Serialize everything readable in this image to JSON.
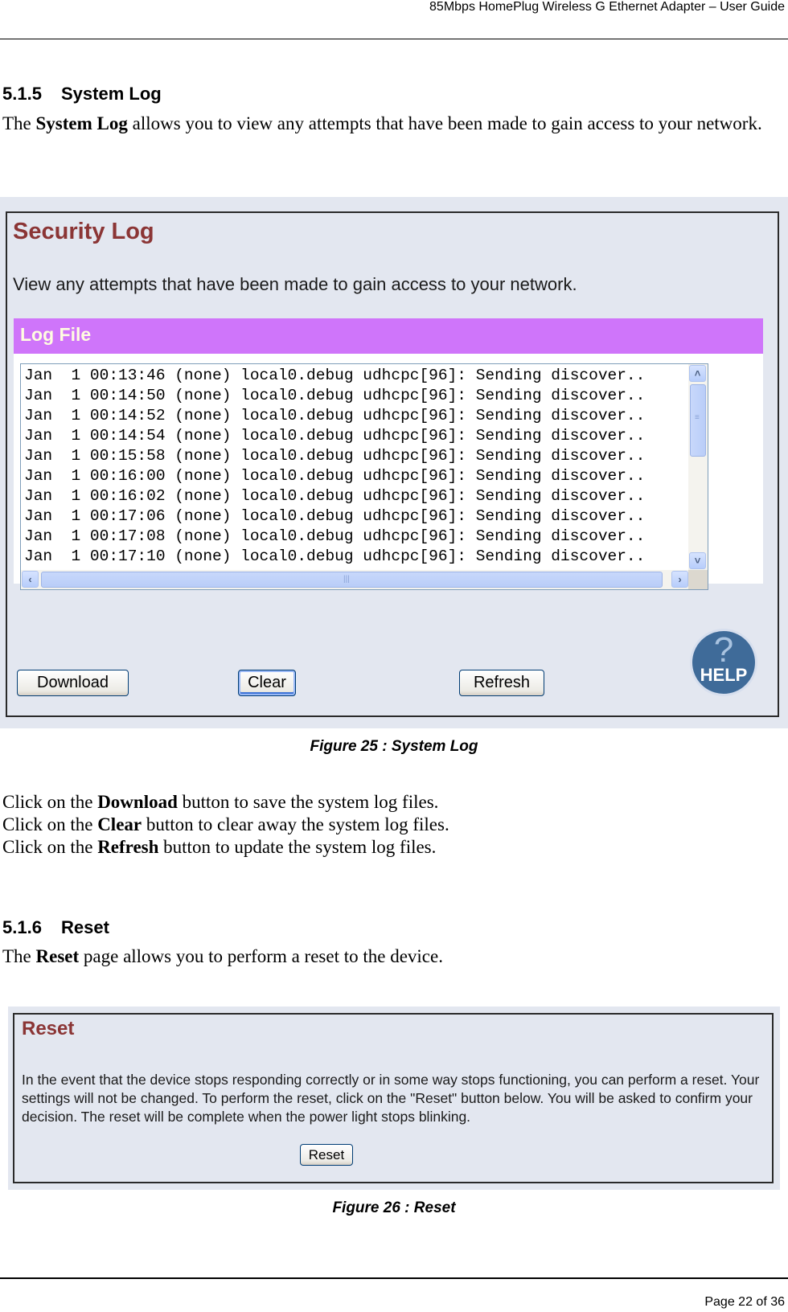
{
  "header": {
    "title": "85Mbps HomePlug Wireless G Ethernet Adapter – User Guide"
  },
  "section_system_log": {
    "number": "5.1.5",
    "title": "System Log",
    "intro_prefix": "The ",
    "intro_bold": "System Log",
    "intro_suffix": " allows you to view any attempts that have been made to gain access to your network."
  },
  "figure25": {
    "panel_title": "Security Log",
    "panel_description": "View any attempts that have been made to gain access to your network.",
    "log_file_label": "Log File",
    "log_lines": [
      "Jan  1 00:13:46 (none) local0.debug udhcpc[96]: Sending discover..",
      "Jan  1 00:14:50 (none) local0.debug udhcpc[96]: Sending discover..",
      "Jan  1 00:14:52 (none) local0.debug udhcpc[96]: Sending discover..",
      "Jan  1 00:14:54 (none) local0.debug udhcpc[96]: Sending discover..",
      "Jan  1 00:15:58 (none) local0.debug udhcpc[96]: Sending discover..",
      "Jan  1 00:16:00 (none) local0.debug udhcpc[96]: Sending discover..",
      "Jan  1 00:16:02 (none) local0.debug udhcpc[96]: Sending discover..",
      "Jan  1 00:17:06 (none) local0.debug udhcpc[96]: Sending discover..",
      "Jan  1 00:17:08 (none) local0.debug udhcpc[96]: Sending discover..",
      "Jan  1 00:17:10 (none) local0.debug udhcpc[96]: Sending discover.."
    ],
    "buttons": {
      "download": "Download",
      "clear": "Clear",
      "refresh": "Refresh"
    },
    "help_icon": {
      "symbol": "?",
      "label": "HELP"
    },
    "scroll_icons": {
      "up": "˄",
      "down": "˅",
      "left": "‹",
      "right": "›",
      "grip_v": "≡",
      "grip_h": "|||"
    },
    "caption": "Figure 25 : System Log"
  },
  "instructions": [
    {
      "prefix": "Click on the ",
      "bold": "Download",
      "suffix": " button to save the system log files."
    },
    {
      "prefix": "Click on the ",
      "bold": "Clear",
      "suffix": " button to clear away the system log files."
    },
    {
      "prefix": "Click on the ",
      "bold": "Refresh",
      "suffix": " button to update the system log files."
    }
  ],
  "section_reset": {
    "number": "5.1.6",
    "title": "Reset",
    "intro_prefix": "The ",
    "intro_bold": "Reset",
    "intro_suffix": " page allows you to perform a reset to the device."
  },
  "figure26": {
    "panel_title": "Reset",
    "panel_description": "In the event that the device stops responding correctly or in some way stops functioning, you can perform a reset. Your settings will not be changed. To perform the reset, click on the \"Reset\" button below. You will be asked to confirm your decision. The reset will be complete when the power light stops blinking.",
    "reset_button": "Reset",
    "caption": "Figure 26 : Reset"
  },
  "footer": {
    "page": "Page 22 of 36"
  }
}
